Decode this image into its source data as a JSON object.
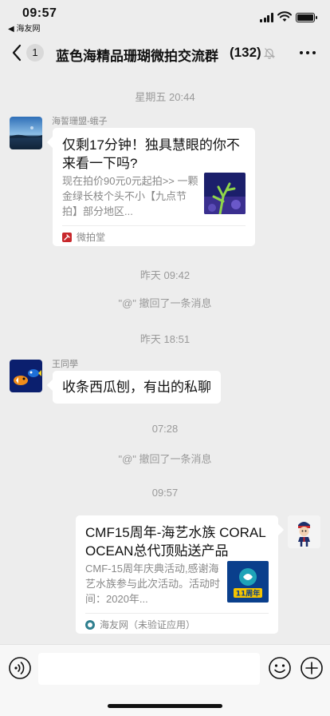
{
  "status": {
    "time": "09:57",
    "back_app": "◀ 海友网"
  },
  "nav": {
    "unread_count": "1",
    "title": "蓝色海精品珊瑚微拍交流群",
    "member_count": "(132)"
  },
  "messages": {
    "ts1": "星期五 20:44",
    "m1": {
      "sender": "海誓珊盟-蛾子",
      "title": "仅剩17分钟！独具慧眼的你不来看一下吗?",
      "desc": "现在拍价90元0元起拍>> 一颗金绿长枝个头不小【九点节拍】部分地区...",
      "source": "微拍堂"
    },
    "ts2": "昨天 09:42",
    "sys1": "\"@\" 撤回了一条消息",
    "ts3": "昨天 18:51",
    "m2": {
      "sender": "王同學",
      "text": "收条西瓜刨，有出的私聊"
    },
    "ts4": "07:28",
    "sys2": "\"@\" 撤回了一条消息",
    "ts5": "09:57",
    "m3": {
      "title": "CMF15周年-海艺水族 CORAL OCEAN总代顶贴送产品",
      "desc": "CMF-15周年庆典活动,感谢海艺水族参与此次活动。活动时间：2020年...",
      "source": "海友网（未验证应用）",
      "thumb_text": "11周年"
    }
  },
  "icons": {
    "back": "chevron-left-icon",
    "mute": "bell-off-icon",
    "more": "more-icon",
    "voice": "voice-icon",
    "emoji": "emoji-icon",
    "plus": "plus-icon"
  },
  "colors": {
    "background": "#ededed",
    "bubble": "#ffffff",
    "muted_text": "#888888",
    "weipaitang_red": "#c8282c"
  }
}
